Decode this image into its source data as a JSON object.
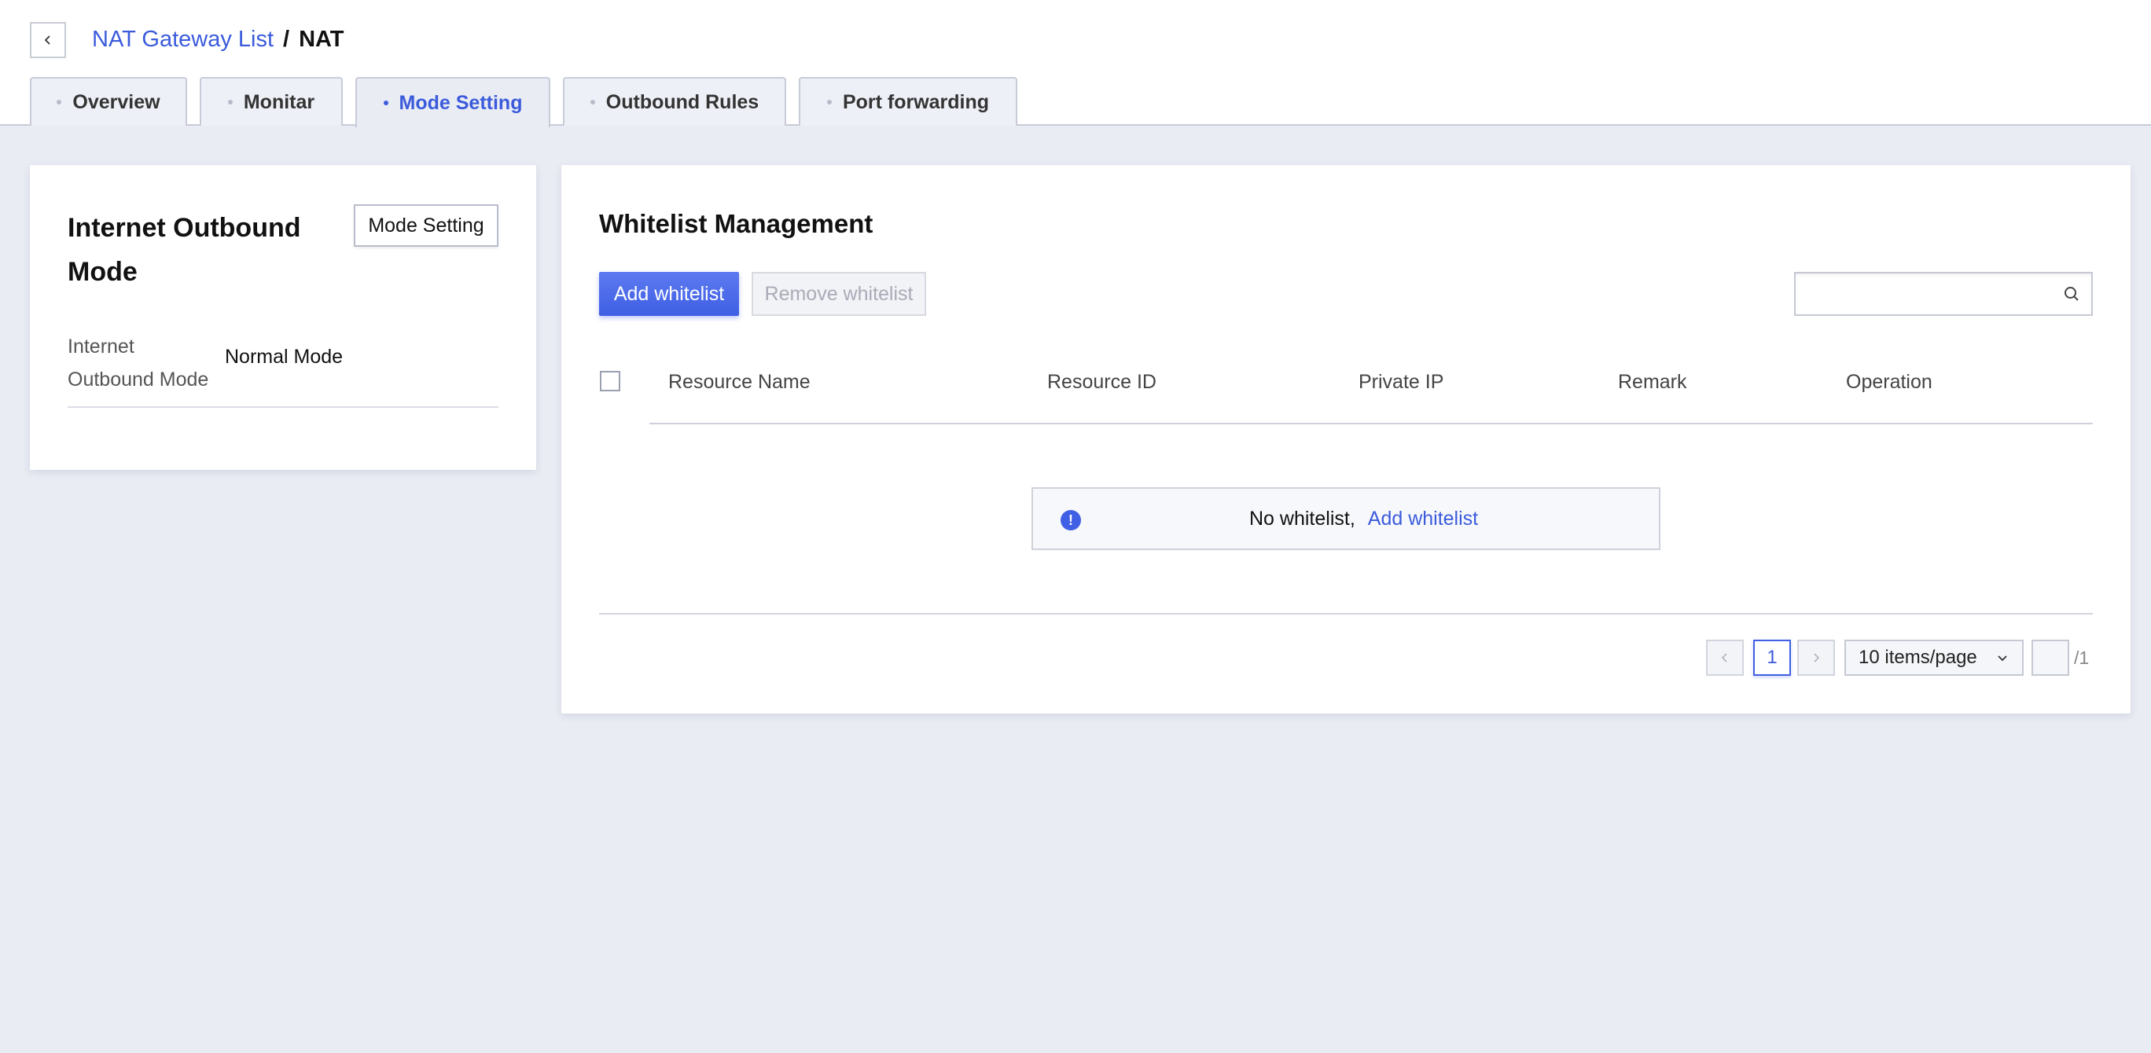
{
  "breadcrumb": {
    "parent": "NAT Gateway List",
    "separator": "/",
    "current": "NAT"
  },
  "tabs": [
    {
      "label": "Overview",
      "active": false
    },
    {
      "label": "Monitar",
      "active": false
    },
    {
      "label": "Mode Setting",
      "active": true
    },
    {
      "label": "Outbound Rules",
      "active": false
    },
    {
      "label": "Port forwarding",
      "active": false
    }
  ],
  "mode_card": {
    "title": "Internet Outbound Mode",
    "button_label": "Mode Setting",
    "field_label": "Internet Outbound Mode",
    "field_value": "Normal Mode"
  },
  "whitelist": {
    "title": "Whitelist Management",
    "add_button": "Add whitelist",
    "remove_button": "Remove whitelist",
    "search_placeholder": "",
    "columns": [
      "Resource Name",
      "Resource ID",
      "Private IP",
      "Remark",
      "Operation"
    ],
    "empty_message": "No whitelist,",
    "empty_link": "Add whitelist"
  },
  "pagination": {
    "current_page": "1",
    "page_size": "10 items/page",
    "jump_value": "",
    "total_pages": "/1"
  },
  "colors": {
    "accent": "#3b5bdb",
    "background": "#eaecf4"
  }
}
